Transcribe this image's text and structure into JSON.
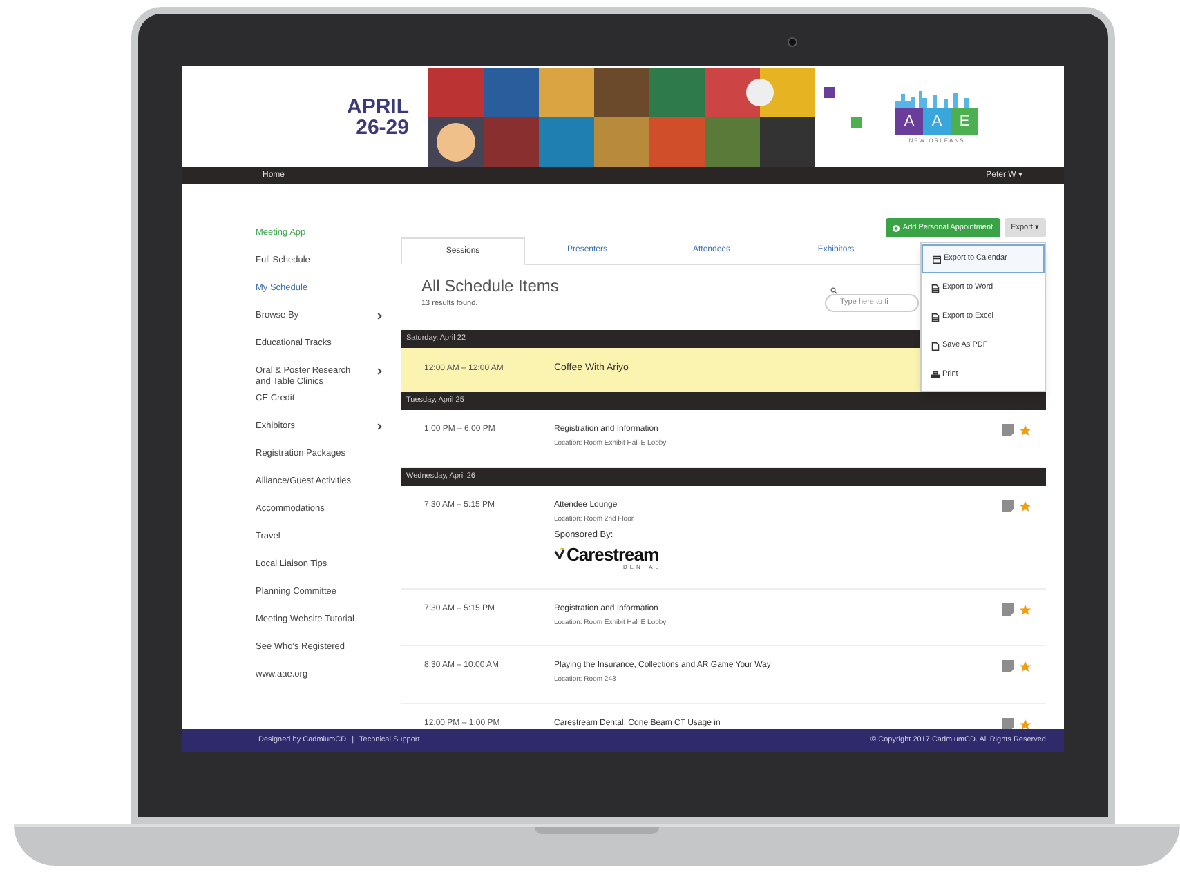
{
  "header": {
    "dates": [
      "APRIL",
      "26-29"
    ],
    "logo": {
      "letters": [
        {
          "letter": "A",
          "color": "#6a3d9a"
        },
        {
          "letter": "A",
          "color": "#3aa7dc"
        },
        {
          "letter": "E",
          "color": "#4caf50"
        }
      ],
      "city": "NEW ORLEANS"
    }
  },
  "nav": {
    "home": "Home",
    "user": "Peter W ▾"
  },
  "sidebar": {
    "items": [
      {
        "label": "Meeting App",
        "color": "#3fa34d",
        "has_submenu": false
      },
      {
        "label": "Full Schedule",
        "color": "#444444",
        "has_submenu": false
      },
      {
        "label": "My Schedule",
        "color": "#3b6fb6",
        "has_submenu": false
      },
      {
        "label": "Browse By",
        "color": "#444444",
        "has_submenu": true
      },
      {
        "label": "Educational Tracks",
        "color": "#444444",
        "has_submenu": false
      },
      {
        "label": "Oral & Poster Research and Table Clinics",
        "color": "#444444",
        "has_submenu": true
      },
      {
        "label": "CE Credit",
        "color": "#444444",
        "has_submenu": false
      },
      {
        "label": "Exhibitors",
        "color": "#444444",
        "has_submenu": true
      },
      {
        "label": "Registration Packages",
        "color": "#444444",
        "has_submenu": false
      },
      {
        "label": "Alliance/Guest Activities",
        "color": "#444444",
        "has_submenu": false
      },
      {
        "label": "Accommodations",
        "color": "#444444",
        "has_submenu": false
      },
      {
        "label": "Travel",
        "color": "#444444",
        "has_submenu": false
      },
      {
        "label": "Local Liaison Tips",
        "color": "#444444",
        "has_submenu": false
      },
      {
        "label": "Planning Committee",
        "color": "#444444",
        "has_submenu": false
      },
      {
        "label": "Meeting Website Tutorial",
        "color": "#444444",
        "has_submenu": false
      },
      {
        "label": "See Who's Registered",
        "color": "#444444",
        "has_submenu": false
      },
      {
        "label": "www.aae.org",
        "color": "#444444",
        "has_submenu": false
      }
    ]
  },
  "toolbar": {
    "add_button": "Add Personal Appointment",
    "export_button": "Export ▾"
  },
  "tabs": [
    {
      "label": "Sessions",
      "selected": true
    },
    {
      "label": "Presenters",
      "selected": false
    },
    {
      "label": "Attendees",
      "selected": false
    },
    {
      "label": "Exhibitors",
      "selected": false
    }
  ],
  "export_menu": [
    {
      "label": "Export to Calendar",
      "kind": "calendar",
      "selected": true
    },
    {
      "label": "Export to Word",
      "kind": "document",
      "selected": false
    },
    {
      "label": "Export to Excel",
      "kind": "document",
      "selected": false
    },
    {
      "label": "Save As PDF",
      "kind": "file",
      "selected": false
    },
    {
      "label": "Print",
      "kind": "print",
      "selected": false
    }
  ],
  "title": "All Schedule Items",
  "results": "13 results found.",
  "search": {
    "placeholder": "Type here to fi"
  },
  "days": [
    {
      "label": "Saturday, April 22",
      "sessions": [
        {
          "time": "12:00 AM – 12:00 AM",
          "title": "Coffee With Ariyo",
          "highlighted": true,
          "large": true
        }
      ]
    },
    {
      "label": "Tuesday, April 25",
      "sessions": [
        {
          "time": "1:00 PM – 6:00 PM",
          "title": "Registration and Information",
          "location": "Location: Room Exhibit Hall E Lobby",
          "highlighted": false,
          "starred": true
        }
      ]
    },
    {
      "label": "Wednesday, April 26",
      "sessions": [
        {
          "time": "7:30 AM – 5:15 PM",
          "title": "Attendee Lounge",
          "location": "Location: Room 2nd Floor",
          "sponsor_label": "Sponsored By:",
          "sponsor": {
            "name": "Carestream",
            "sub": "DENTAL"
          },
          "highlighted": false,
          "starred": true
        },
        {
          "time": "7:30 AM – 5:15 PM",
          "title": "Registration and Information",
          "location": "Location: Room Exhibit Hall E Lobby",
          "highlighted": false,
          "starred": true
        },
        {
          "time": "8:30 AM – 10:00 AM",
          "title": "Playing the Insurance, Collections and AR Game Your Way",
          "location": "Location: Room 243",
          "highlighted": false,
          "starred": true
        },
        {
          "time": "12:00 PM – 1:00 PM",
          "title": "Carestream Dental: Cone Beam CT Usage in",
          "highlighted": false,
          "starred": true
        }
      ]
    }
  ],
  "footer": {
    "left": "Designed by CadmiumCD",
    "separator": "|",
    "link": "Technical Support",
    "right": "© Copyright 2017 CadmiumCD. All Rights Reserved"
  }
}
